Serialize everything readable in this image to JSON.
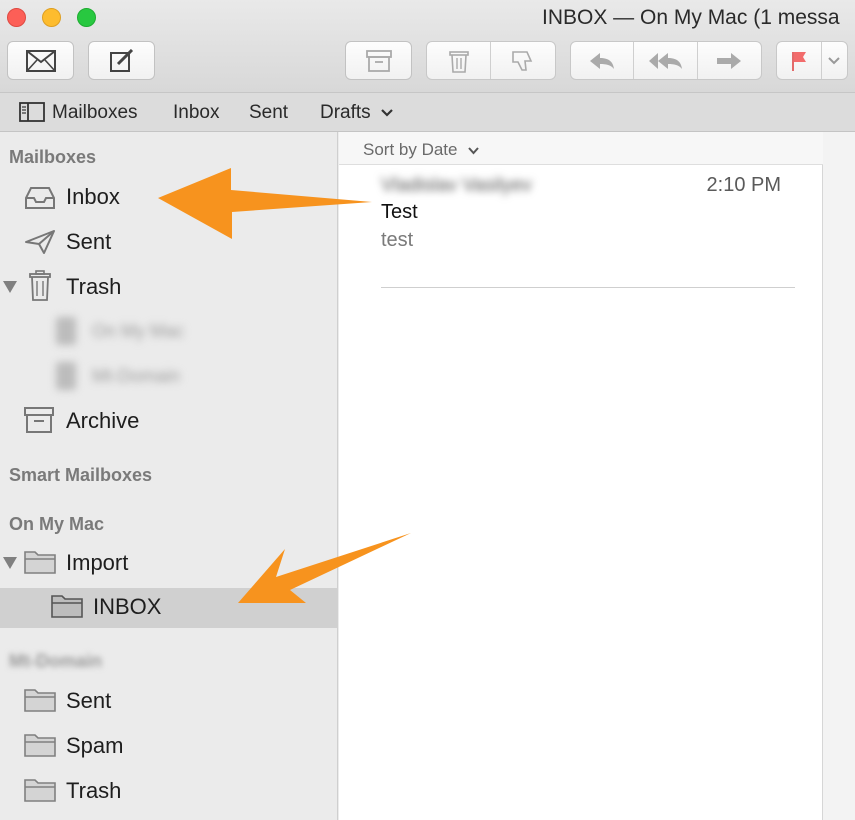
{
  "window": {
    "title": "INBOX — On My Mac (1 messa"
  },
  "toolbar": {
    "icons": [
      "envelope-icon",
      "compose-icon",
      "archive-icon",
      "trash-icon",
      "junk-icon",
      "reply-icon",
      "reply-all-icon",
      "forward-icon",
      "flag-icon",
      "chevron-down-icon"
    ]
  },
  "favorites": {
    "mailboxes": "Mailboxes",
    "inbox": "Inbox",
    "sent": "Sent",
    "drafts": "Drafts"
  },
  "sidebar": {
    "mailboxes_header": "Mailboxes",
    "inbox": "Inbox",
    "sent": "Sent",
    "trash": "Trash",
    "trash_children": [
      "On My Mac",
      "Mt-Domain"
    ],
    "archive": "Archive",
    "smart_header": "Smart Mailboxes",
    "onmymac_header": "On My Mac",
    "import": "Import",
    "import_inbox": "INBOX",
    "account_header": "Mt-Domain",
    "account_items": [
      "Sent",
      "Spam",
      "Trash"
    ]
  },
  "message_list": {
    "sort_label": "Sort by Date",
    "messages": [
      {
        "sender": "Vladislav Vasilyev",
        "time": "2:10 PM",
        "subject": "Test",
        "preview": "test"
      }
    ]
  },
  "colors": {
    "arrow": "#f7931e",
    "selected_row": "#d0d0d0",
    "flag": "#f26c6c"
  }
}
